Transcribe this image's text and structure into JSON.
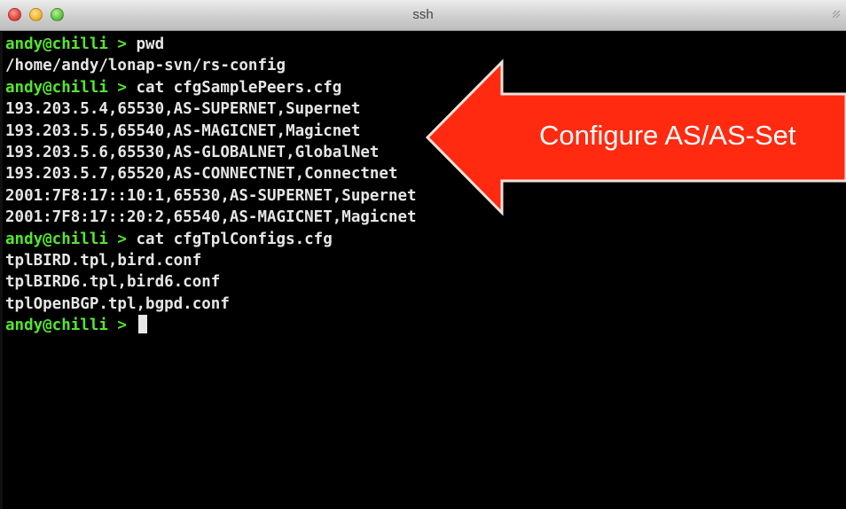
{
  "window": {
    "title": "ssh",
    "controls": [
      "close",
      "minimize",
      "zoom"
    ],
    "resize_icon": "resize-diagonal-icon"
  },
  "terminal": {
    "prompt": "andy@chilli >",
    "lines": [
      {
        "type": "prompt",
        "command": " pwd"
      },
      {
        "type": "output",
        "text": "/home/andy/lonap-svn/rs-config"
      },
      {
        "type": "prompt",
        "command": " cat cfgSamplePeers.cfg"
      },
      {
        "type": "output",
        "text": "193.203.5.4,65530,AS-SUPERNET,Supernet"
      },
      {
        "type": "output",
        "text": "193.203.5.5,65540,AS-MAGICNET,Magicnet"
      },
      {
        "type": "output",
        "text": "193.203.5.6,65530,AS-GLOBALNET,GlobalNet"
      },
      {
        "type": "output",
        "text": "193.203.5.7,65520,AS-CONNECTNET,Connectnet"
      },
      {
        "type": "output",
        "text": "2001:7F8:17::10:1,65530,AS-SUPERNET,Supernet"
      },
      {
        "type": "output",
        "text": "2001:7F8:17::20:2,65540,AS-MAGICNET,Magicnet"
      },
      {
        "type": "prompt",
        "command": " cat cfgTplConfigs.cfg"
      },
      {
        "type": "output",
        "text": "tplBIRD.tpl,bird.conf"
      },
      {
        "type": "output",
        "text": "tplBIRD6.tpl,bird6.conf"
      },
      {
        "type": "output",
        "text": "tplOpenBGP.tpl,bgpd.conf"
      },
      {
        "type": "prompt",
        "command": " "
      }
    ]
  },
  "callout": {
    "label": "Configure AS/AS-Set",
    "color": "#ff2a10",
    "border_color": "#f0e0d8"
  },
  "colors": {
    "prompt": "#55e62e",
    "output": "#e6e6e6",
    "background": "#000000"
  }
}
